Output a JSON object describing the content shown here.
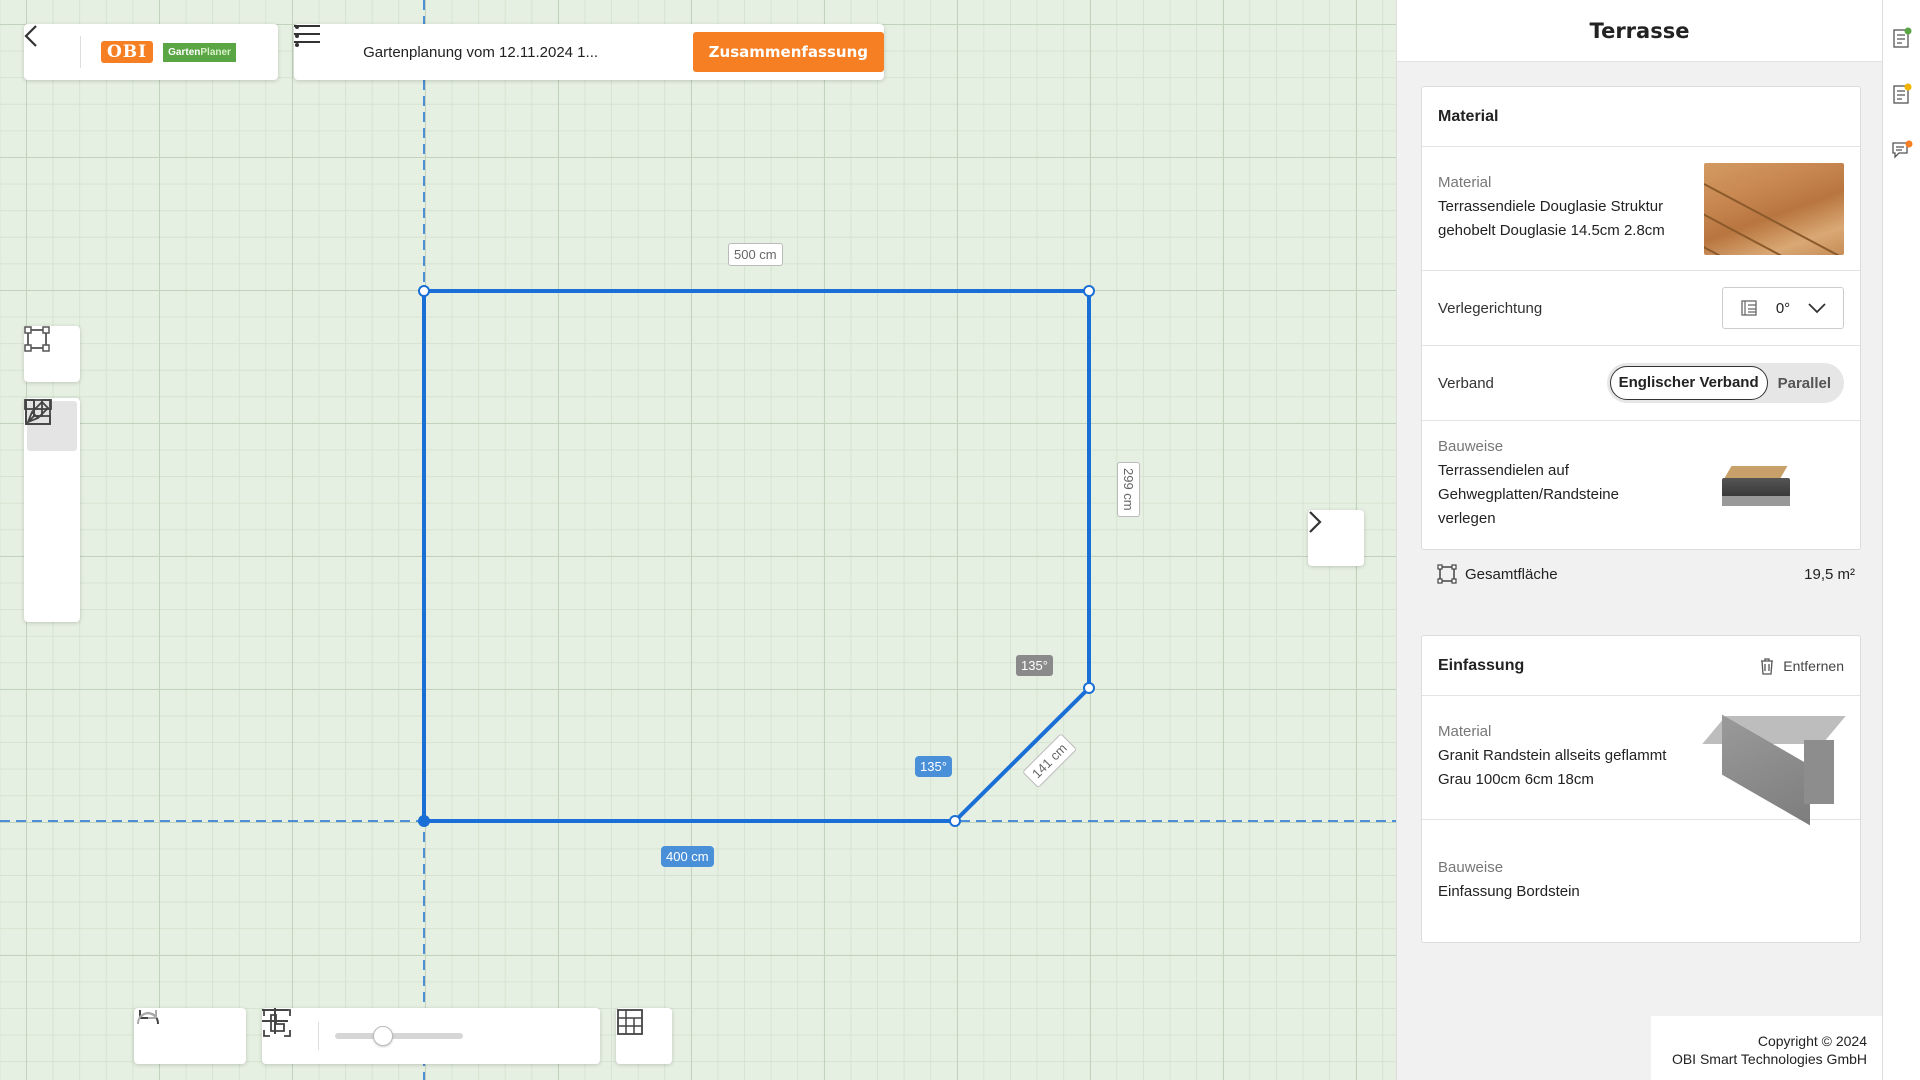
{
  "header": {
    "brand_logo": "OBI",
    "brand_sub_a": "Garten",
    "brand_sub_b": "Planer",
    "plan_title": "Gartenplanung vom 12.11.2024 1...",
    "summary_label": "Zusammenfassung"
  },
  "canvas": {
    "dim_top": "500 cm",
    "dim_right": "299 cm",
    "dim_bottom": "400 cm",
    "dim_diag": "141 cm",
    "angle_upper": "135°",
    "angle_lower": "135°"
  },
  "panel": {
    "title": "Terrasse",
    "material_section": {
      "heading": "Material",
      "material_label": "Material",
      "material_value": "Terrassendiele Douglasie Struktur gehobelt Douglasie 14.5cm 2.8cm",
      "direction_label": "Verlegerichtung",
      "direction_value": "0°",
      "bond_label": "Verband",
      "bond_options": [
        "Englischer Verband",
        "Parallel"
      ],
      "construction_label": "Bauweise",
      "construction_value": "Terrassendielen auf Gehwegplatten/Randsteine verlegen"
    },
    "total_area_label": "Gesamtfläche",
    "total_area_value": "19,5 m²",
    "edging_section": {
      "heading": "Einfassung",
      "remove_label": "Entfernen",
      "material_label": "Material",
      "material_value": "Granit Randstein allseits geflammt Grau 100cm 6cm 18cm",
      "construction_label": "Bauweise",
      "construction_value": "Einfassung Bordstein"
    }
  },
  "footer": {
    "copyright_line1": "Copyright © 2024",
    "copyright_line2": "OBI Smart Technologies GmbH"
  },
  "colors": {
    "accent": "#f57f22",
    "shape": "#1a6fd6",
    "grid_bg": "#e6f0e2"
  }
}
